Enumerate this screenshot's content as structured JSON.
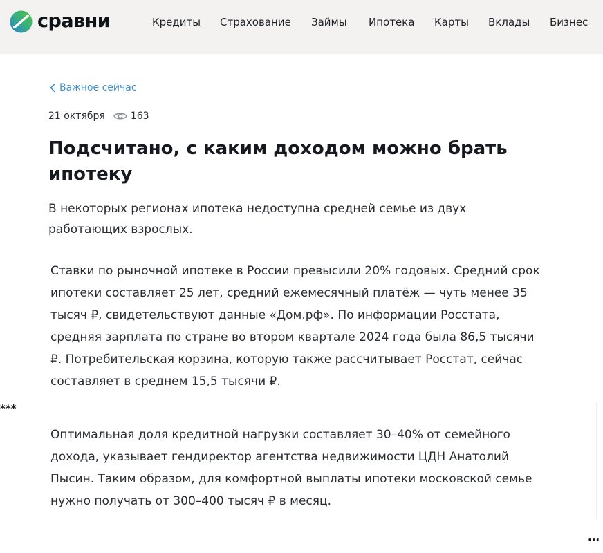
{
  "header": {
    "logo_text": "сравни",
    "nav": [
      {
        "label": "Кредиты"
      },
      {
        "label": "Страхование"
      },
      {
        "label": "Займы"
      },
      {
        "label": "Ипотека"
      },
      {
        "label": "Карты"
      },
      {
        "label": "Вклады"
      },
      {
        "label": "Бизнес"
      }
    ]
  },
  "article": {
    "back_label": "Важное сейчас",
    "date": "21 октября",
    "views": "163",
    "title": "Подсчитано, с каким доходом можно брать ипотеку",
    "lead": "В некоторых регионах ипотека недоступна средней семье из двух работающих взрослых.",
    "paragraphs": [
      "Ставки по рыночной ипотеке в России превысили 20% годовых. Средний срок ипотеки составляет 25 лет, средний ежемесячный платёж — чуть менее 35 тысяч ₽, свидетельствуют данные «Дом.рф». По информации Росстата, средняя зарплата по стране во втором квартале 2024 года была 86,5 тысячи ₽. Потребительская корзина, которую также рассчитывает Росстат, сейчас составляет в среднем 15,5 тысячи ₽.",
      "Оптимальная доля кредитной нагрузки составляет 30–40% от семейного дохода, указывает гендиректор агентства недвижимости ЦДН Анатолий Пысин. Таким образом, для комфортной выплаты ипотеки московской семье нужно получать от 300–400 тысяч ₽ в месяц."
    ]
  },
  "separator": "***",
  "ellipsis": "...",
  "colors": {
    "link": "#3d93cf",
    "header_bg": "#f3f2f1",
    "text": "#2a2d33",
    "logo_green": "#3bb54a",
    "logo_blue": "#2a7fd4"
  }
}
